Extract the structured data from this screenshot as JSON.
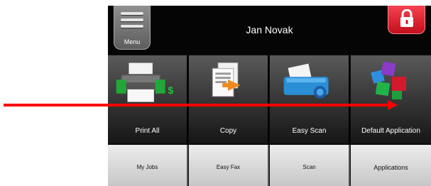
{
  "header": {
    "menu_label": "Menu",
    "user_name": "Jan Novak",
    "lock_icon": "padlock-icon"
  },
  "tiles": [
    {
      "label": "Print All",
      "icon": "printer-icon",
      "badge": "$"
    },
    {
      "label": "Copy",
      "icon": "copy-documents-icon"
    },
    {
      "label": "Easy Scan",
      "icon": "scanner-icon"
    },
    {
      "label": "Default Application",
      "icon": "applications-cubes-icon"
    }
  ],
  "bottom_buttons": [
    {
      "label": "My Jobs"
    },
    {
      "label": "Easy Fax"
    },
    {
      "label": "Scan"
    },
    {
      "label": "Applications"
    }
  ],
  "colors": {
    "lock_button": "#e01b28",
    "annotation_arrow": "#ff0000",
    "badge_green": "#22c23a"
  }
}
